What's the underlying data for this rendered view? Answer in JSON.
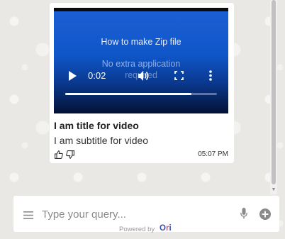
{
  "video": {
    "title": "How to make Zip file",
    "subtitle_line1": "No extra application",
    "subtitle_line2": "required",
    "current_time": "0:02",
    "progress": 0.83
  },
  "card": {
    "title": "I am title for video",
    "subtitle": "I am subtitle for video",
    "time": "05:07 PM"
  },
  "input": {
    "placeholder": "Type your query..."
  },
  "footer": {
    "powered_by": "Powered by",
    "brand_o": "O",
    "brand_r": "r",
    "brand_i": "i"
  },
  "icons": {
    "play": "play-icon",
    "volume": "volume-icon",
    "fullscreen": "fullscreen-icon",
    "more": "more-vertical-icon",
    "thumb_up": "thumb-up-icon",
    "thumb_down": "thumb-down-icon",
    "menu": "menu-icon",
    "mic": "mic-icon",
    "add": "add-circle-icon"
  },
  "colors": {
    "brand_blue": "#3a4ea8",
    "brand_pink": "#e05a7a"
  }
}
